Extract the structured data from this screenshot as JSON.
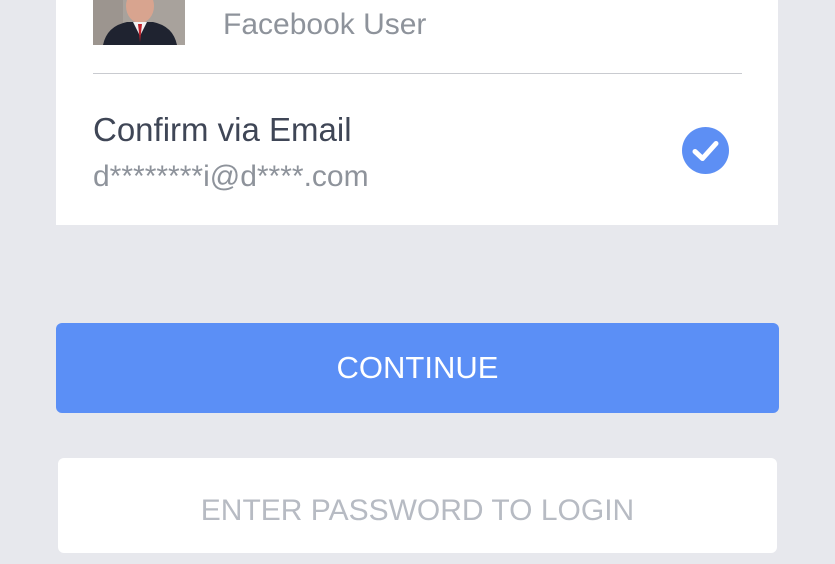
{
  "account": {
    "user_label": "Facebook User"
  },
  "confirm_option": {
    "title": "Confirm via Email",
    "email_masked": "d********i@d****.com",
    "selected": true
  },
  "actions": {
    "continue_label": "CONTINUE",
    "password_login_label": "ENTER PASSWORD TO LOGIN"
  },
  "icons": {
    "check": "check-circle-icon",
    "avatar": "profile-photo"
  },
  "colors": {
    "background": "#e7e8ed",
    "accent": "#5b8ff6",
    "title_text": "#3f4656",
    "secondary_text": "#8e939b",
    "disabled_text": "#b7bbc3"
  }
}
